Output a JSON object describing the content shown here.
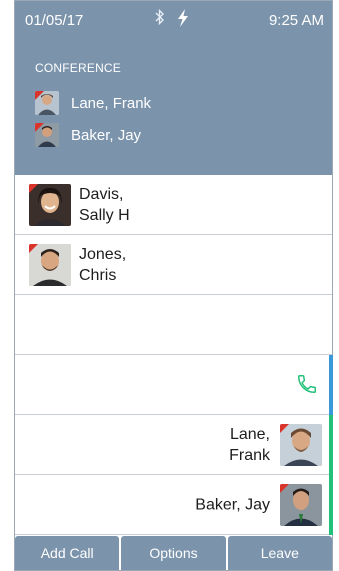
{
  "status_bar": {
    "date": "01/05/17",
    "time": "9:25 AM",
    "icons": [
      "bluetooth-icon",
      "power-bolt-icon"
    ]
  },
  "conference": {
    "label": "CONFERENCE",
    "participants": [
      {
        "name": "Lane, Frank",
        "avatar": "avatar-lane-frank"
      },
      {
        "name": "Baker, Jay",
        "avatar": "avatar-baker-jay"
      }
    ]
  },
  "list": {
    "left_items": [
      {
        "name_line1": "Davis,",
        "name_line2": "Sally H"
      },
      {
        "name_line1": "Jones,",
        "name_line2": "Chris"
      }
    ],
    "right_items": [
      {
        "name_line1": "Lane,",
        "name_line2": "Frank"
      },
      {
        "name_line1": "Baker, Jay",
        "name_line2": ""
      }
    ],
    "call_icon": "phone-icon"
  },
  "actions": {
    "add_call": "Add Call",
    "options": "Options",
    "leave": "Leave"
  },
  "colors": {
    "header": "#7b93ab",
    "missed_indicator": "#d9332c",
    "accent_blue": "#3a9ad9",
    "accent_green": "#22c17a"
  }
}
